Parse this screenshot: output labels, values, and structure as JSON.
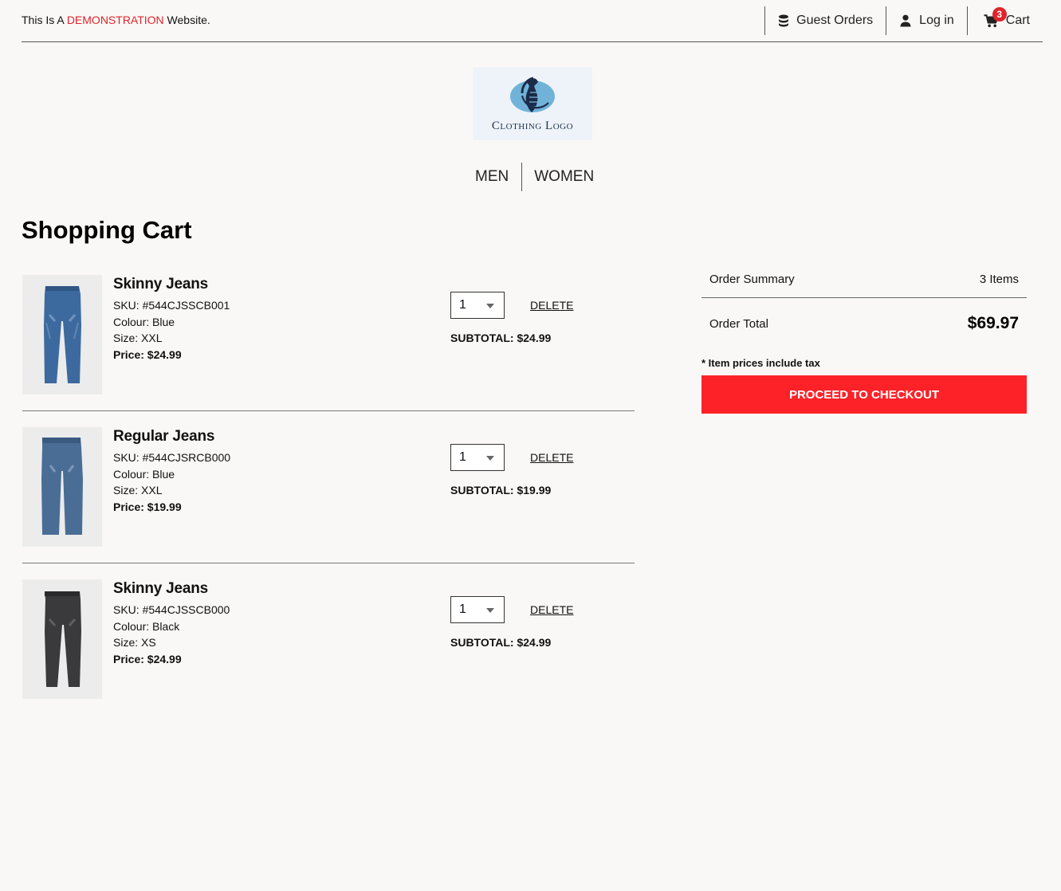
{
  "topbar": {
    "demo_prefix": "This Is A ",
    "demo_highlight": "DEMONSTRATION",
    "demo_suffix": " Website.",
    "guest_orders": "Guest Orders",
    "login": "Log in",
    "cart": "Cart",
    "cart_count": "3"
  },
  "logo": {
    "text": "Clothing Logo"
  },
  "nav": {
    "men": "MEN",
    "women": "WOMEN"
  },
  "page_title": "Shopping Cart",
  "items": [
    {
      "name": "Skinny Jeans",
      "sku": "SKU: #544CJSSCB001",
      "colour": "Colour: Blue",
      "size": "Size: XXL",
      "price": "Price: $24.99",
      "qty": "1",
      "delete": "DELETE",
      "subtotal": "SUBTOTAL: $24.99"
    },
    {
      "name": "Regular Jeans",
      "sku": "SKU: #544CJSRCB000",
      "colour": "Colour: Blue",
      "size": "Size: XXL",
      "price": "Price: $19.99",
      "qty": "1",
      "delete": "DELETE",
      "subtotal": "SUBTOTAL: $19.99"
    },
    {
      "name": "Skinny Jeans",
      "sku": "SKU: #544CJSSCB000",
      "colour": "Colour: Black",
      "size": "Size: XS",
      "price": "Price: $24.99",
      "qty": "1",
      "delete": "DELETE",
      "subtotal": "SUBTOTAL: $24.99"
    }
  ],
  "summary": {
    "label": "Order Summary",
    "count": "3 Items",
    "total_label": "Order Total",
    "total": "$69.97",
    "tax_note": "* Item prices include tax",
    "checkout": "PROCEED TO CHECKOUT"
  },
  "colors": {
    "accent": "#e0242b",
    "checkout": "#fc2228",
    "background": "#faf8f6"
  }
}
